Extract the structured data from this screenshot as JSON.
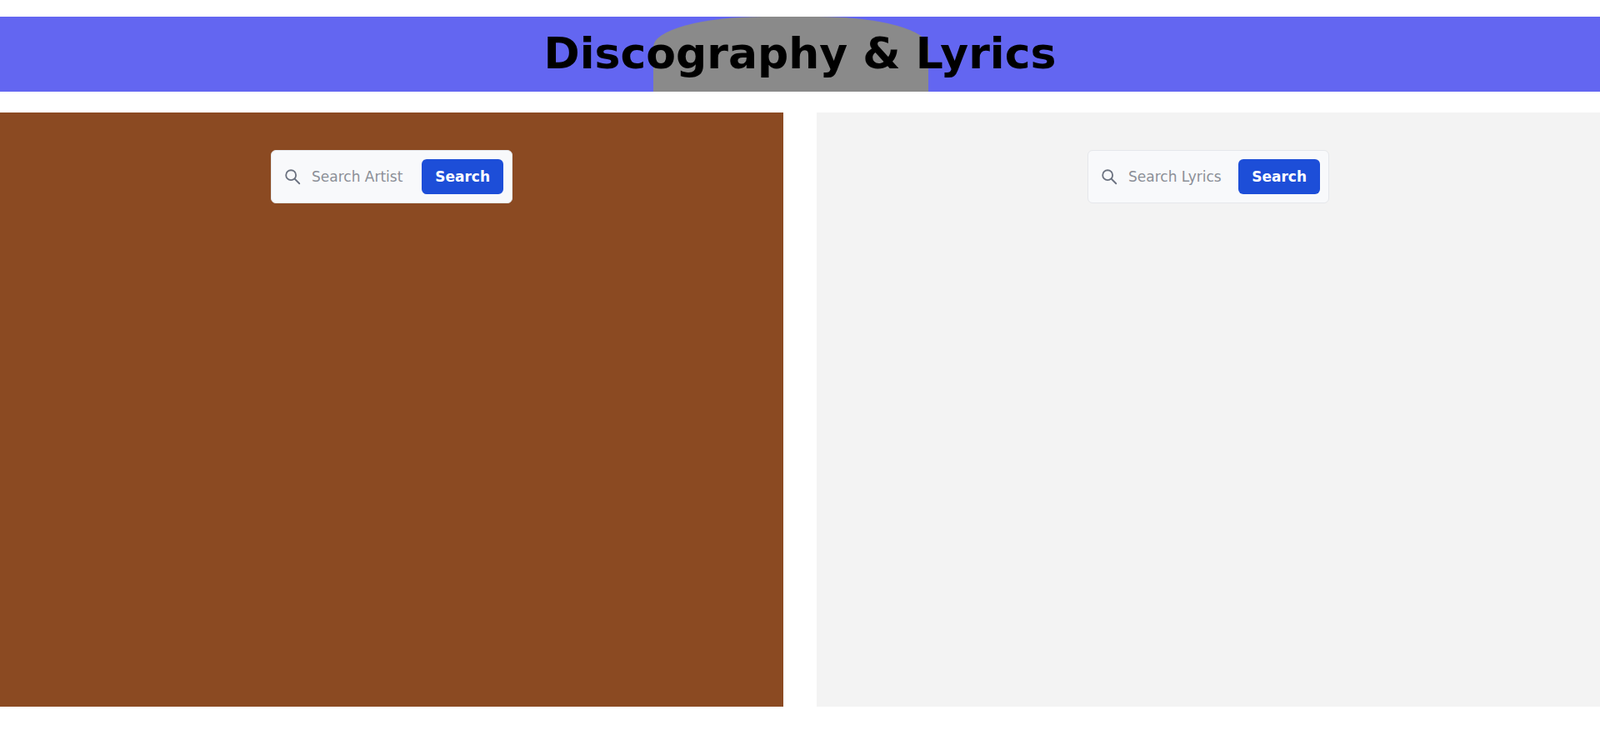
{
  "header": {
    "title": "Discography & Lyrics"
  },
  "panels": [
    {
      "kind": "artist",
      "search": {
        "placeholder": "Search Artist",
        "button": "Search"
      }
    },
    {
      "kind": "lyrics",
      "search": {
        "placeholder": "Search Lyrics",
        "button": "Search"
      }
    }
  ]
}
